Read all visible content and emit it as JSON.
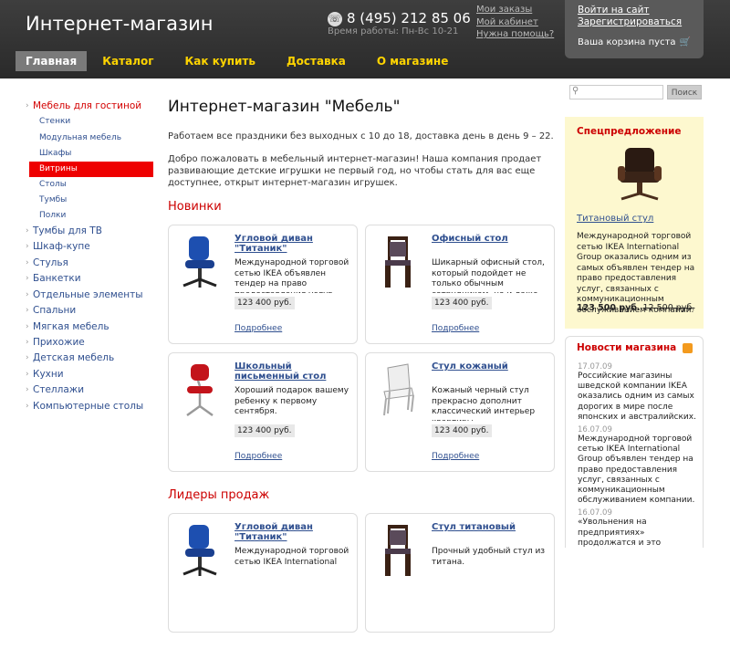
{
  "header": {
    "logo": "Интернет-магазин",
    "phone": "8 (495) 212 85 06",
    "hours": "Время работы: Пн-Вс 10-21",
    "links": [
      "Мои заказы",
      "Мой кабинет",
      "Нужна помощь?"
    ],
    "login": "Войти на сайт",
    "register": "Зарегистрироваться",
    "cart": "Ваша корзина пуста"
  },
  "nav": [
    "Главная",
    "Каталог",
    "Как купить",
    "Доставка",
    "О магазине"
  ],
  "sidebar": {
    "items": [
      {
        "label": "Мебель для гостиной",
        "type": "item",
        "red": true
      },
      {
        "label": "Стенки",
        "type": "sub"
      },
      {
        "label": "Модульная мебель",
        "type": "sub"
      },
      {
        "label": "Шкафы",
        "type": "sub"
      },
      {
        "label": "Витрины",
        "type": "sub",
        "selected": true
      },
      {
        "label": "Столы",
        "type": "sub"
      },
      {
        "label": "Тумбы",
        "type": "sub"
      },
      {
        "label": "Полки",
        "type": "sub"
      },
      {
        "label": "Тумбы для ТВ",
        "type": "item"
      },
      {
        "label": "Шкаф-купе",
        "type": "item"
      },
      {
        "label": "Стулья",
        "type": "item"
      },
      {
        "label": "Банкетки",
        "type": "item"
      },
      {
        "label": "Отдельные элементы",
        "type": "item"
      },
      {
        "label": "Спальни",
        "type": "item"
      },
      {
        "label": "Мягкая мебель",
        "type": "item"
      },
      {
        "label": "Прихожие",
        "type": "item"
      },
      {
        "label": "Детская мебель",
        "type": "item"
      },
      {
        "label": "Кухни",
        "type": "item"
      },
      {
        "label": "Стеллажи",
        "type": "item"
      },
      {
        "label": "Компьютерные столы",
        "type": "item"
      }
    ]
  },
  "main": {
    "title": "Интернет-магазин \"Мебель\"",
    "p1": "Работаем все праздники без выходных с 10 до 18, доставка день в день 9 – 22.",
    "p2": "Добро пожаловать в мебельный интернет-магазин! Наша компания продает развивающие детские игрушки не первый год, но чтобы стать для вас еще доступнее, открыт интернет-магазин игрушек.",
    "new_title": "Новинки",
    "leaders_title": "Лидеры продаж",
    "more_label": "Подробнее",
    "new_products": [
      {
        "title": "Угловой диван \"Титаник\"",
        "desc": "Международной торговой сетью IKEA объявлен тендер на право предоставления услуг, связанных с коммуникационным",
        "price": "123 400 руб.",
        "img": "office-chair-blue"
      },
      {
        "title": "Офисный стол",
        "desc": "Шикарный офисный стол, который подойдет не только обычным сотрудникам, но и даже директорам компаний.",
        "price": "123 400 руб.",
        "img": "wooden-chair"
      },
      {
        "title": "Школьный письменный стол",
        "desc": "Хороший подарок вашему ребенку к первому сентября.",
        "price": "123 400 руб.",
        "img": "red-chair"
      },
      {
        "title": "Стул кожаный",
        "desc": "Кожаный черный стул прекрасно дополнит классический интерьер квартиры.",
        "price": "123 400 руб.",
        "img": "white-chair"
      }
    ],
    "leader_products": [
      {
        "title": "Угловой диван \"Титаник\"",
        "desc": "Международной торговой сетью IKEA International",
        "img": "office-chair-blue"
      },
      {
        "title": "Стул титановый",
        "desc": "Прочный удобный стул из титана.",
        "img": "wooden-chair"
      }
    ]
  },
  "search": {
    "placeholder": "",
    "button": "Поиск"
  },
  "special": {
    "title": "Спецпредложение",
    "name": "Титановый стул",
    "desc": "Международной торговой сетью IKEA International Group оказались одним из самых объявлен тендер на право предоставления услуг, связанных с коммуникационным обслуживанием компании.",
    "price": "123 500 руб.",
    "old_price": "12 500 руб."
  },
  "news": {
    "title": "Новости магазина",
    "items": [
      {
        "date": "17.07.09",
        "text": "Российские магазины шведской компании IKEA оказались одним из самых дорогих в мире после японских и австралийских."
      },
      {
        "date": "16.07.09",
        "text": "Международной торговой сетью IKEA International Group объявлен тендер на право предоставления услуг, связанных с коммуникационным обслуживанием компании."
      },
      {
        "date": "16.07.09",
        "text": "«Увольнения на предприятиях» продолжатся и это неизбежно, - уверен Александр Гордеев."
      }
    ]
  }
}
